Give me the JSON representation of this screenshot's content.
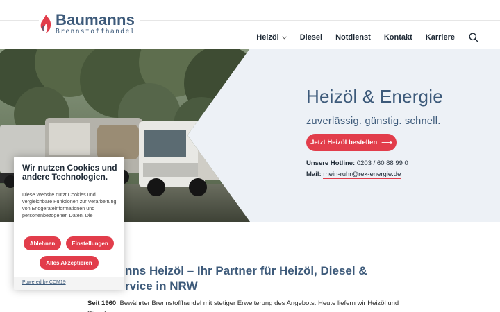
{
  "brand": {
    "name": "Baumanns",
    "subtitle": "Brennstoffhandel",
    "flame_color": "#e23d4b",
    "text_color": "#3d5a7a"
  },
  "nav": {
    "items": [
      {
        "label": "Heizöl",
        "has_dropdown": true
      },
      {
        "label": "Diesel"
      },
      {
        "label": "Notdienst"
      },
      {
        "label": "Kontakt"
      },
      {
        "label": "Karriere"
      }
    ],
    "search_icon": "search-icon"
  },
  "hero": {
    "image": "tanker-trucks-photo",
    "title": "Heizöl & Energie",
    "subtitle": "zuverlässig. günstig. schnell.",
    "cta_label": "Jetzt Heizöl bestellen",
    "cta_icon": "arrow-right-icon",
    "hotline_label": "Unsere Hotline:",
    "hotline_number": "0203 / 60 88 99 0",
    "mail_label": "Mail:",
    "mail_address": "rhein-ruhr@rek-energie.de"
  },
  "content": {
    "title_visible": "nns Heizöl – Ihr Partner für Heizöl, Diesel &",
    "title_line2": "rvice in NRW",
    "intro_bold": "Seit 1960",
    "intro_text": ": Bewährter Brennstoffhandel mit stetiger Erweiterung des Angebots. Heute liefern wir Heizöl und Diesel"
  },
  "cookie": {
    "title": "Wir nutzen Cookies und andere Technologien.",
    "description": "Diese Website nutzt Cookies und vergleichbare Funktionen zur Verarbeitung von Endgeräteinformationen und personenbezogenen Daten. Die",
    "reject_label": "Ablehnen",
    "settings_label": "Einstellungen",
    "accept_label": "Alles Akzeptieren",
    "powered_by": "Powered by CCM19"
  },
  "colors": {
    "accent": "#e23d4b",
    "heading": "#3d5a7a",
    "hero_bg": "#edf1f6"
  }
}
